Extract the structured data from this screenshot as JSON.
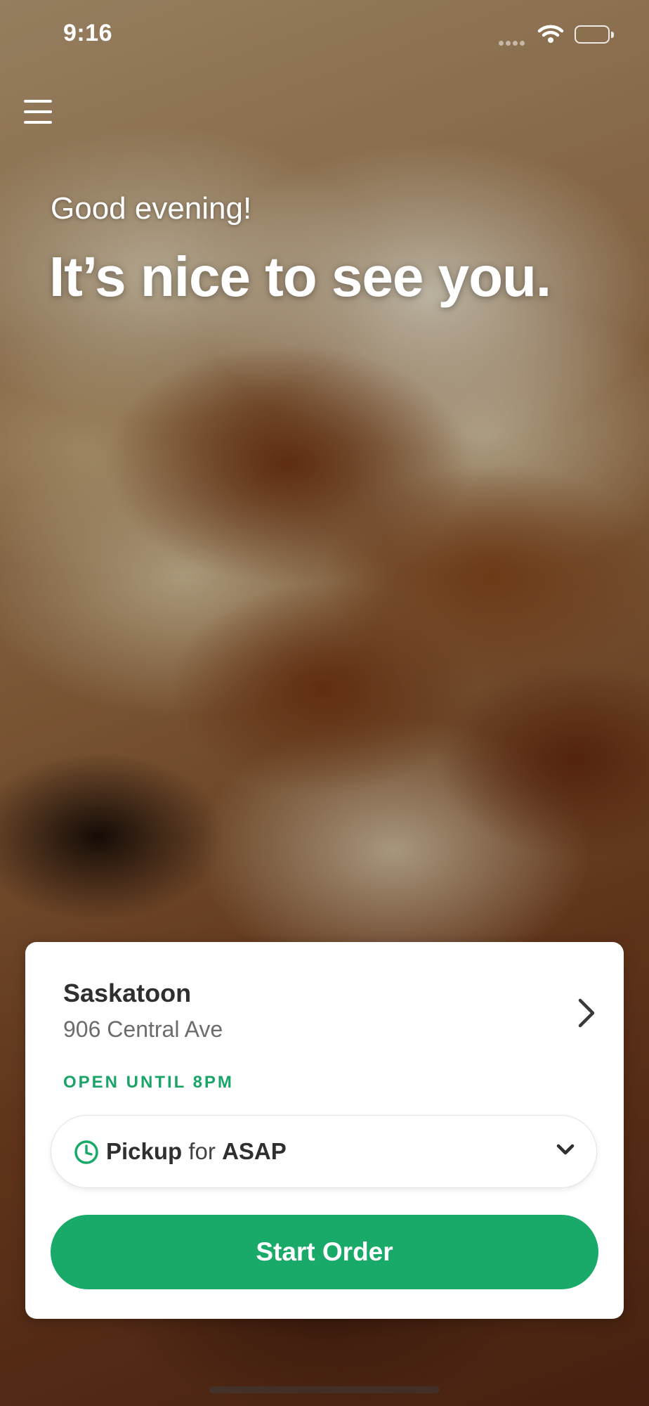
{
  "status_bar": {
    "time": "9:16",
    "icons": [
      "signal-icon",
      "wifi-icon",
      "battery-icon"
    ]
  },
  "header": {
    "menu_icon": "hamburger-menu-icon"
  },
  "hero": {
    "greeting": "Good evening!",
    "headline": "It’s nice to see you."
  },
  "location_card": {
    "location_name": "Saskatoon",
    "address": "906 Central Ave",
    "hours": "OPEN UNTIL 8PM",
    "pickup": {
      "mode": "Pickup",
      "connector": "for",
      "time": "ASAP"
    },
    "start_order_label": "Start Order"
  },
  "colors": {
    "accent_green": "#19aa69",
    "hours_green": "#1aa468",
    "text_dark": "#2f2f2f",
    "text_muted": "#6c6c6c"
  }
}
